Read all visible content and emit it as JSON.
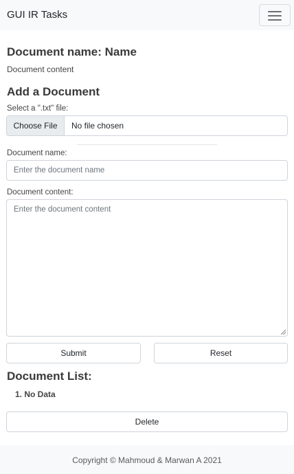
{
  "navbar": {
    "brand": "GUI IR Tasks",
    "toggler_icon": "hamburger-menu-icon"
  },
  "document": {
    "name_heading": "Document name: Name",
    "content": "Document content"
  },
  "add_form": {
    "heading": "Add a Document",
    "file_label": "Select a \".txt\" file:",
    "file_button": "Choose File",
    "file_status": "No file chosen",
    "name_label": "Document name:",
    "name_placeholder": "Enter the document name",
    "content_label": "Document content:",
    "content_placeholder": "Enter the document content",
    "submit_label": "Submit",
    "reset_label": "Reset"
  },
  "document_list": {
    "heading": "Document List:",
    "items": [
      "1. No Data"
    ],
    "delete_label": "Delete"
  },
  "footer": {
    "text": "Copyright © Mahmoud & Marwan A 2021"
  }
}
